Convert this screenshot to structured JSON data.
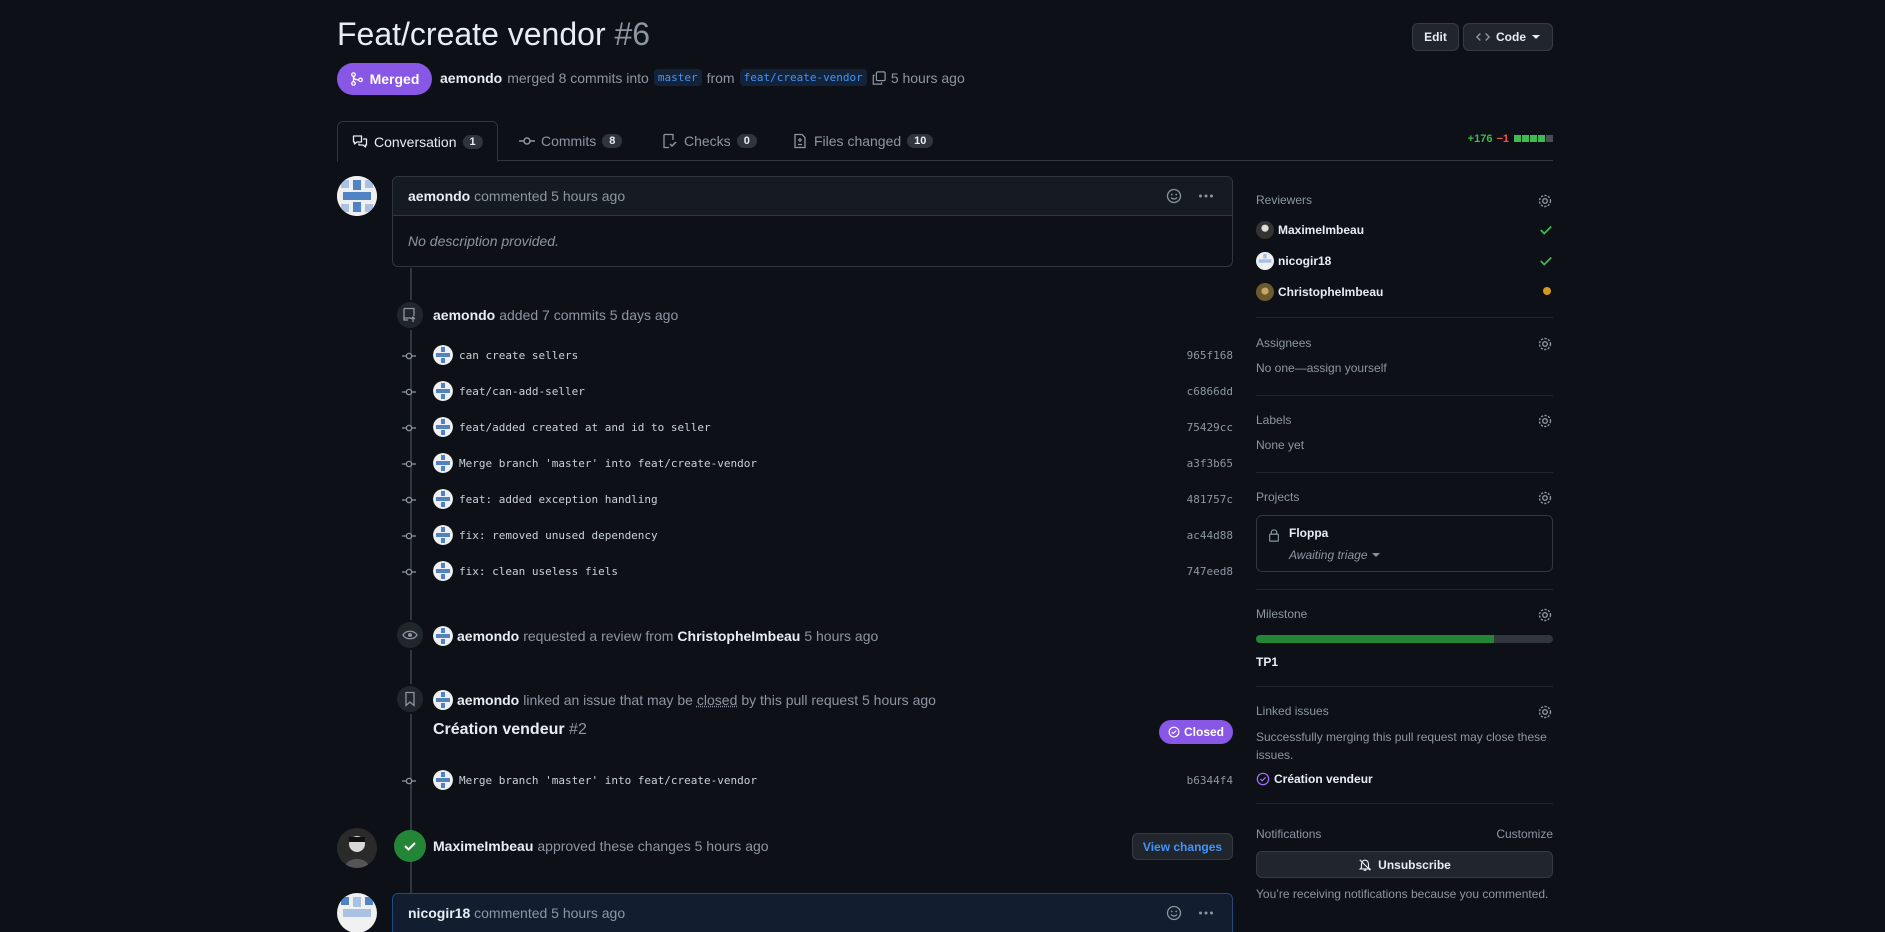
{
  "header": {
    "title": "Feat/create vendor",
    "number": "#6",
    "edit_label": "Edit",
    "code_label": "Code",
    "state_label": "Merged",
    "author": "aemondo",
    "merge_text": "merged 8 commits into",
    "base_branch": "master",
    "from_text": "from",
    "head_branch": "feat/create-vendor",
    "time": "5 hours ago"
  },
  "tabs": [
    {
      "label": "Conversation",
      "count": "1"
    },
    {
      "label": "Commits",
      "count": "8"
    },
    {
      "label": "Checks",
      "count": "0"
    },
    {
      "label": "Files changed",
      "count": "10"
    }
  ],
  "diffstat": {
    "additions": "+176",
    "deletions": "−1",
    "blocks": [
      "green",
      "green",
      "green",
      "green",
      "gray"
    ]
  },
  "first_comment": {
    "author": "aemondo",
    "meta": "commented 5 hours ago",
    "body": "No description provided."
  },
  "commits_event": {
    "author": "aemondo",
    "text": "added 7 commits 5 days ago"
  },
  "commits": [
    {
      "message": "can create sellers",
      "sha": "965f168"
    },
    {
      "message": "feat/can-add-seller",
      "sha": "c6866dd"
    },
    {
      "message": "feat/added created at and id to seller",
      "sha": "75429cc"
    },
    {
      "message": "Merge branch 'master' into feat/create-vendor",
      "sha": "a3f3b65"
    },
    {
      "message": "feat: added exception handling",
      "sha": "481757c"
    },
    {
      "message": "fix: removed unused dependency",
      "sha": "ac44d88"
    },
    {
      "message": "fix: clean useless fiels",
      "sha": "747eed8"
    }
  ],
  "review_request": {
    "author": "aemondo",
    "text": "requested a review from",
    "target": "ChristopheImbeau",
    "time": "5 hours ago"
  },
  "linked_event": {
    "author": "aemondo",
    "text_before": "linked an issue that may be",
    "closed_word": "closed",
    "text_after": "by this pull request 5 hours ago",
    "issue_title": "Création vendeur",
    "issue_number": "#2",
    "issue_state": "Closed"
  },
  "late_commit": {
    "message": "Merge branch 'master' into feat/create-vendor",
    "sha": "b6344f4"
  },
  "approval": {
    "author": "MaximeImbeau",
    "text": "approved these changes 5 hours ago",
    "button": "View changes"
  },
  "second_comment": {
    "author": "nicogir18",
    "meta": "commented 5 hours ago"
  },
  "sidebar": {
    "reviewers_title": "Reviewers",
    "reviewers": [
      {
        "name": "MaximeImbeau",
        "status": "approved"
      },
      {
        "name": "nicogir18",
        "status": "approved"
      },
      {
        "name": "ChristopheImbeau",
        "status": "pending"
      }
    ],
    "assignees_title": "Assignees",
    "assignees_text": "No one—assign yourself",
    "labels_title": "Labels",
    "labels_text": "None yet",
    "projects_title": "Projects",
    "project_name": "Floppa",
    "project_status": "Awaiting triage",
    "milestone_title": "Milestone",
    "milestone_progress": 0.8,
    "milestone_name": "TP1",
    "linked_title": "Linked issues",
    "linked_text": "Successfully merging this pull request may close these issues.",
    "linked_issue": "Création vendeur",
    "notifications_title": "Notifications",
    "customize": "Customize",
    "unsubscribe": "Unsubscribe",
    "notif_text": "You’re receiving notifications because you commented."
  },
  "colors": {
    "merged": "#8957e5",
    "green": "#238636",
    "link": "#4493f8",
    "pending": "#d29922"
  }
}
